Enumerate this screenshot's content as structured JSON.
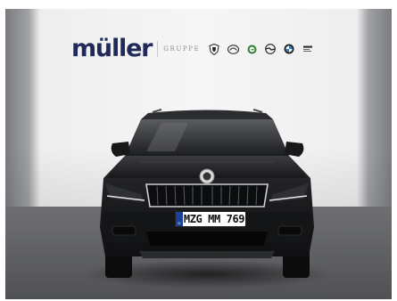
{
  "banner": {
    "logo_text": "müller",
    "sub_text": "GRUPPE",
    "brand_marks": [
      {
        "name": "peugeot-icon",
        "label": ""
      },
      {
        "name": "mazda-icon",
        "label": ""
      },
      {
        "name": "skoda-icon",
        "label": ""
      },
      {
        "name": "opel-icon",
        "label": ""
      },
      {
        "name": "bmw-icon",
        "label": ""
      },
      {
        "name": "service-icon",
        "label": ""
      }
    ]
  },
  "vehicle": {
    "plate_text": "MZG MM 769",
    "color": "#1a1b1d"
  },
  "colors": {
    "brand_navy": "#1f2a5b",
    "wall": "#f6f6f6",
    "floor": "#5d5e61"
  }
}
